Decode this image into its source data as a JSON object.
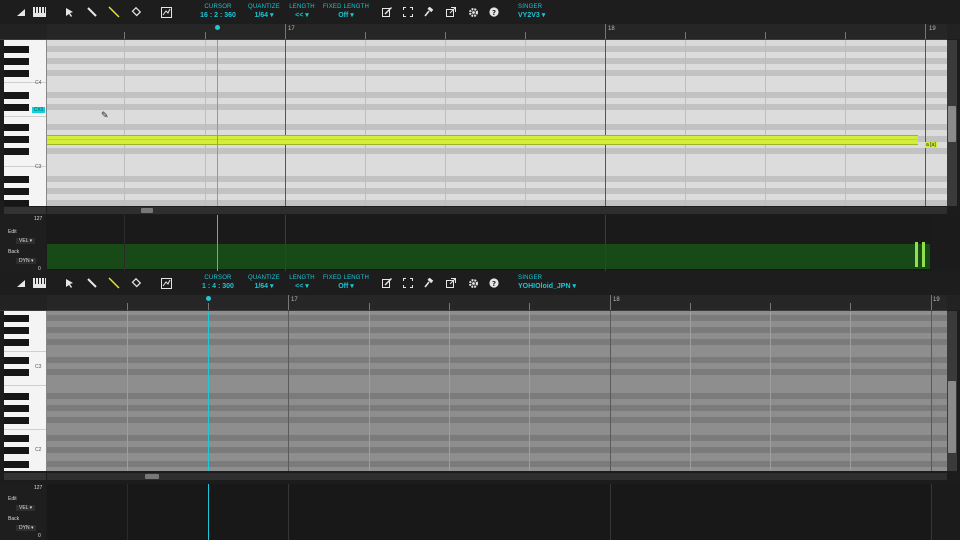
{
  "editor_top": {
    "toolbar": {
      "cursor": {
        "label": "CURSOR",
        "value": "16 : 2 : 360"
      },
      "quantize": {
        "label": "QUANTIZE",
        "value": "1/64 ▾"
      },
      "length": {
        "label": "LENGTH",
        "value": "<< ▾"
      },
      "fixed_length": {
        "label": "FIXED LENGTH",
        "value": "Off ▾"
      },
      "singer": {
        "label": "SINGER",
        "value": "VY2V3 ▾"
      }
    },
    "ruler": {
      "marks": [
        "17",
        "18",
        "19"
      ]
    },
    "keys": {
      "c4": "C4",
      "c3": "C3",
      "hover": "C#3"
    },
    "note_lyric": "a [a]",
    "param": {
      "max": "127",
      "min": "0",
      "edit": "Edit",
      "back": "Back",
      "edit_select": "VEL ▾",
      "back_select": "DYN ▾"
    },
    "colors": {
      "note": "#d4ec3a",
      "cursor": "#1fc8d8",
      "param_bg": "#174a17"
    }
  },
  "editor_bottom": {
    "toolbar": {
      "cursor": {
        "label": "CURSOR",
        "value": "1 : 4 : 300"
      },
      "quantize": {
        "label": "QUANTIZE",
        "value": "1/64 ▾"
      },
      "length": {
        "label": "LENGTH",
        "value": "<< ▾"
      },
      "fixed_length": {
        "label": "FIXED LENGTH",
        "value": "Off ▾"
      },
      "singer": {
        "label": "SINGER",
        "value": "YOHIOloid_JPN ▾"
      }
    },
    "ruler": {
      "marks": [
        "17",
        "18",
        "19"
      ]
    },
    "keys": {
      "c3": "C3",
      "c2": "C2"
    },
    "param": {
      "max": "127",
      "min": "0",
      "edit": "Edit",
      "back": "Back",
      "edit_select": "VEL ▾",
      "back_select": "DYN ▾"
    }
  },
  "icons": [
    "keyboard-toggle-icon",
    "piano-icon",
    "arrow-tool-icon",
    "pencil-tool-icon",
    "line-tool-icon",
    "eraser-tool-icon",
    "grid-tool-icon",
    "edit-icon",
    "fullscreen-icon",
    "hammer-icon",
    "export-icon",
    "gear-icon",
    "help-icon"
  ]
}
